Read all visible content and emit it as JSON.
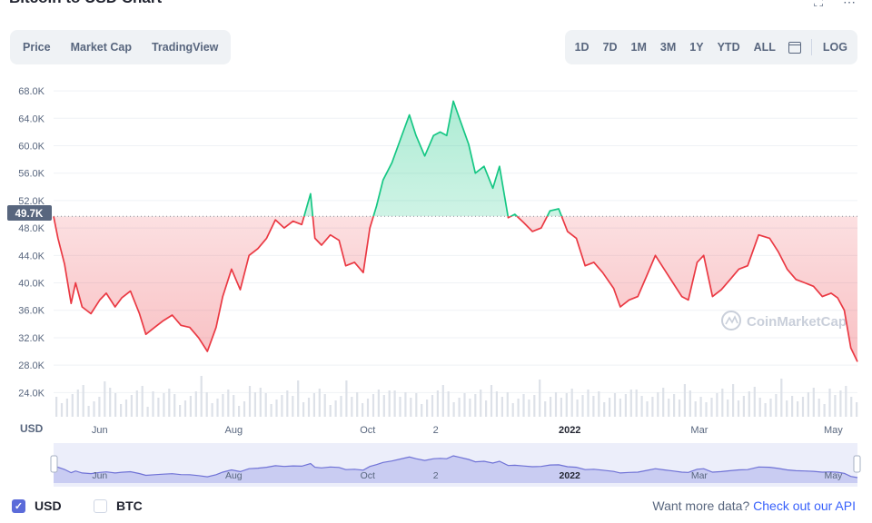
{
  "title": "Bitcoin to USD Chart",
  "toolbar": {
    "tabs": [
      {
        "label": "Price",
        "active": true
      },
      {
        "label": "Market Cap",
        "active": false
      },
      {
        "label": "TradingView",
        "active": false
      }
    ],
    "ranges": [
      {
        "label": "1D",
        "active": false
      },
      {
        "label": "7D",
        "active": false
      },
      {
        "label": "1M",
        "active": false
      },
      {
        "label": "3M",
        "active": false
      },
      {
        "label": "1Y",
        "active": true
      },
      {
        "label": "YTD",
        "active": false
      },
      {
        "label": "ALL",
        "active": false
      }
    ],
    "calendar_icon": "calendar-icon",
    "log_label": "LOG"
  },
  "watermark": "CoinMarketCap",
  "footer": {
    "usd_label": "USD",
    "usd_checked": true,
    "btc_label": "BTC",
    "btc_checked": false,
    "more_text": "Want more data?",
    "api_link": "Check out our API"
  },
  "colors": {
    "up": "#16c784",
    "down": "#ea3943",
    "navigator": "#6f72d6",
    "checkbox": "#5b6bd9",
    "link": "#3861fb"
  },
  "chart_data": {
    "type": "line",
    "currency_label": "USD",
    "baseline_value": 49700,
    "baseline_label": "49.7K",
    "yticks": [
      {
        "value": 24000,
        "label": "24.0K"
      },
      {
        "value": 28000,
        "label": "28.0K"
      },
      {
        "value": 32000,
        "label": "32.0K"
      },
      {
        "value": 36000,
        "label": "36.0K"
      },
      {
        "value": 40000,
        "label": "40.0K"
      },
      {
        "value": 44000,
        "label": "44.0K"
      },
      {
        "value": 48000,
        "label": "48.0K"
      },
      {
        "value": 52000,
        "label": "52.0K"
      },
      {
        "value": 56000,
        "label": "56.0K"
      },
      {
        "value": 60000,
        "label": "60.0K"
      },
      {
        "value": 64000,
        "label": "64.0K"
      },
      {
        "value": 68000,
        "label": "68.0K"
      }
    ],
    "ylim": [
      21000,
      70000
    ],
    "xlim": [
      "2021-05-11",
      "2022-05-12"
    ],
    "xticks": [
      {
        "date": "2021-06-01",
        "label": "Jun"
      },
      {
        "date": "2021-08-01",
        "label": "Aug"
      },
      {
        "date": "2021-10-01",
        "label": "Oct"
      },
      {
        "date": "2021-11-01",
        "label": "2"
      },
      {
        "date": "2022-01-01",
        "label": "2022"
      },
      {
        "date": "2022-03-01",
        "label": "Mar"
      },
      {
        "date": "2022-05-01",
        "label": "May"
      }
    ],
    "series": [
      {
        "x": [
          "2021-05-11",
          "2021-05-13",
          "2021-05-16",
          "2021-05-19",
          "2021-05-21",
          "2021-05-24",
          "2021-05-28",
          "2021-06-01",
          "2021-06-04",
          "2021-06-08",
          "2021-06-11",
          "2021-06-15",
          "2021-06-19",
          "2021-06-22",
          "2021-06-26",
          "2021-06-30",
          "2021-07-04",
          "2021-07-08",
          "2021-07-12",
          "2021-07-16",
          "2021-07-20",
          "2021-07-24",
          "2021-07-27",
          "2021-07-31",
          "2021-08-04",
          "2021-08-08",
          "2021-08-12",
          "2021-08-16",
          "2021-08-20",
          "2021-08-24",
          "2021-08-28",
          "2021-09-01",
          "2021-09-05",
          "2021-09-07",
          "2021-09-10",
          "2021-09-14",
          "2021-09-18",
          "2021-09-21",
          "2021-09-25",
          "2021-09-29",
          "2021-10-02",
          "2021-10-05",
          "2021-10-08",
          "2021-10-12",
          "2021-10-16",
          "2021-10-20",
          "2021-10-23",
          "2021-10-27",
          "2021-10-31",
          "2021-11-03",
          "2021-11-06",
          "2021-11-09",
          "2021-11-12",
          "2021-11-16",
          "2021-11-19",
          "2021-11-23",
          "2021-11-27",
          "2021-11-30",
          "2021-12-04",
          "2021-12-07",
          "2021-12-11",
          "2021-12-15",
          "2021-12-19",
          "2021-12-23",
          "2021-12-27",
          "2021-12-31",
          "2022-01-04",
          "2022-01-08",
          "2022-01-12",
          "2022-01-16",
          "2022-01-21",
          "2022-01-24",
          "2022-01-28",
          "2022-02-01",
          "2022-02-05",
          "2022-02-09",
          "2022-02-13",
          "2022-02-17",
          "2022-02-21",
          "2022-02-24",
          "2022-02-28",
          "2022-03-03",
          "2022-03-07",
          "2022-03-11",
          "2022-03-15",
          "2022-03-19",
          "2022-03-23",
          "2022-03-28",
          "2022-04-02",
          "2022-04-06",
          "2022-04-10",
          "2022-04-14",
          "2022-04-18",
          "2022-04-22",
          "2022-04-26",
          "2022-04-30",
          "2022-05-03",
          "2022-05-06",
          "2022-05-09",
          "2022-05-12"
        ],
        "values": [
          49700,
          46500,
          42700,
          37000,
          40000,
          36500,
          35500,
          37500,
          38500,
          36500,
          37800,
          38800,
          35600,
          32500,
          33500,
          34500,
          35300,
          33800,
          33500,
          32000,
          30000,
          33500,
          38000,
          42000,
          39000,
          44000,
          45000,
          46500,
          49200,
          48000,
          49000,
          48500,
          53000,
          46500,
          45500,
          47000,
          46200,
          42500,
          43000,
          41500,
          48000,
          51200,
          55000,
          57500,
          61000,
          64500,
          61500,
          58500,
          61500,
          62000,
          61500,
          66500,
          63800,
          60200,
          56000,
          57000,
          53800,
          57000,
          49500,
          50000,
          48800,
          47500,
          48000,
          50500,
          50800,
          47500,
          46500,
          42500,
          43000,
          41500,
          39200,
          36500,
          37500,
          38000,
          41000,
          44000,
          42000,
          40000,
          38000,
          37500,
          43000,
          44000,
          38000,
          39000,
          40500,
          42000,
          42500,
          47000,
          46500,
          44500,
          42000,
          40500,
          40000,
          39500,
          38000,
          38500,
          37800,
          36000,
          30500,
          28500
        ]
      }
    ]
  }
}
